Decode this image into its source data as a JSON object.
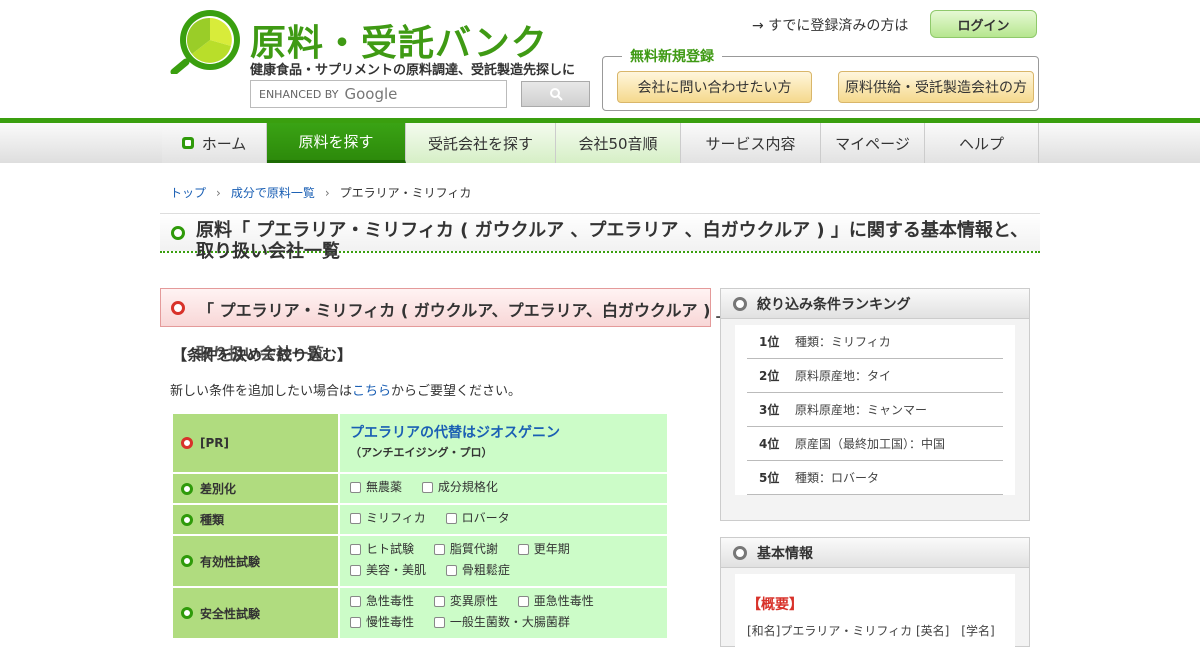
{
  "header": {
    "logo_title": "原料・受託バンク",
    "tagline": "健康食品・サプリメントの原料調達、受託製造先探しに",
    "search_placeholder": "ENHANCED BY",
    "search_brand": "Google",
    "already_registered": "→ すでに登録済みの方は",
    "login_label": "ログイン",
    "register_label": "無料新規登録",
    "register_inquire": "会社に問い合わせたい方",
    "register_supplier": "原料供給・受託製造会社の方"
  },
  "nav": {
    "items": [
      {
        "label": "ホーム"
      },
      {
        "label": "原料を探す"
      },
      {
        "label": "受託会社を探す"
      },
      {
        "label": "会社50音順"
      },
      {
        "label": "サービス内容"
      },
      {
        "label": "マイページ"
      },
      {
        "label": "ヘルプ"
      }
    ]
  },
  "breadcrumb": {
    "top": "トップ",
    "list": "成分で原料一覧",
    "current": "プエラリア・ミリフィカ"
  },
  "page_title": "原料「 プエラリア・ミリフィカ ( ガウクルア 、プエラリア 、白ガウクルア ) 」に関する基本情報と、取り扱い会社一覧",
  "section": {
    "title": "「 プエラリア・ミリフィカ ( ガウクルア、プエラリア、白ガウクルア ) 」",
    "subtitle": "取り扱い会社一覧",
    "filter_heading": "【条件を決めて絞り込む】",
    "note_before": "新しい条件を追加したい場合は",
    "note_link": "こちら",
    "note_after": "からご要望ください。"
  },
  "filters": {
    "pr": {
      "label": "[PR]",
      "link": "プエラリアの代替はジオスゲニン",
      "sub": "（アンチエイジング・プロ）"
    },
    "rows": [
      {
        "label": "差別化",
        "options": [
          "無農薬",
          "成分規格化"
        ]
      },
      {
        "label": "種類",
        "options": [
          "ミリフィカ",
          "ロバータ"
        ]
      },
      {
        "label": "有効性試験",
        "options": [
          "ヒト試験",
          "脂質代謝",
          "更年期",
          "美容・美肌",
          "骨粗鬆症"
        ]
      },
      {
        "label": "安全性試験",
        "options": [
          "急性毒性",
          "変異原性",
          "亜急性毒性",
          "慢性毒性",
          "一般生菌数・大腸菌群"
        ]
      }
    ]
  },
  "ranking": {
    "title": "絞り込み条件ランキング",
    "items": [
      {
        "pos": "1位",
        "text": "種類：ミリフィカ"
      },
      {
        "pos": "2位",
        "text": "原料原産地：タイ"
      },
      {
        "pos": "3位",
        "text": "原料原産地：ミャンマー"
      },
      {
        "pos": "4位",
        "text": "原産国（最終加工国）：中国"
      },
      {
        "pos": "5位",
        "text": "種類：ロバータ"
      }
    ]
  },
  "basic": {
    "title": "基本情報",
    "overview": "【概要】",
    "text": "[和名]プエラリア・ミリフィカ [英名]　[学名]"
  },
  "colors": {
    "brand_green": "#3a9f0f",
    "accent_red": "#d8322a"
  }
}
